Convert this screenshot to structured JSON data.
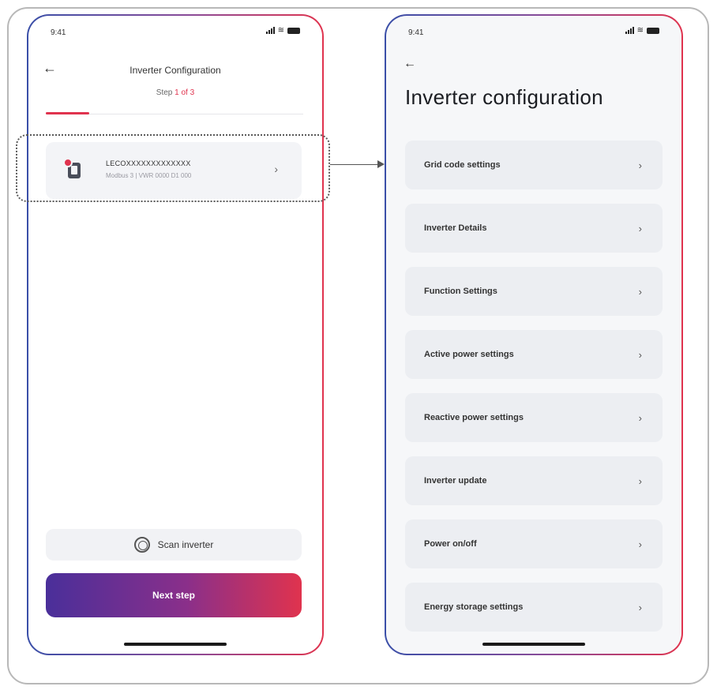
{
  "left_screen": {
    "status_time": "9:41",
    "title": "Inverter Configuration",
    "step_label": "Step",
    "step_value": "1 of 3",
    "device": {
      "serial": "LECOXXXXXXXXXXXXX",
      "subtitle": "Modbus 3 | VWR 0000 D1 000"
    },
    "scan_button_label": "Scan inverter",
    "next_button_label": "Next step",
    "progress_fraction": 0.17
  },
  "right_screen": {
    "status_time": "9:41",
    "title": "Inverter configuration",
    "menu_items": [
      "Grid code settings",
      "Inverter Details",
      "Function Settings",
      "Active power settings",
      "Reactive power settings",
      "Inverter update",
      "Power on/off",
      "Energy storage settings"
    ]
  },
  "glyphs": {
    "back_arrow": "←",
    "chevron": "›",
    "wifi": "≋"
  },
  "colors": {
    "accent": "#e0334e",
    "gradient_start": "#4a2f9a",
    "gradient_end": "#e0334e"
  }
}
